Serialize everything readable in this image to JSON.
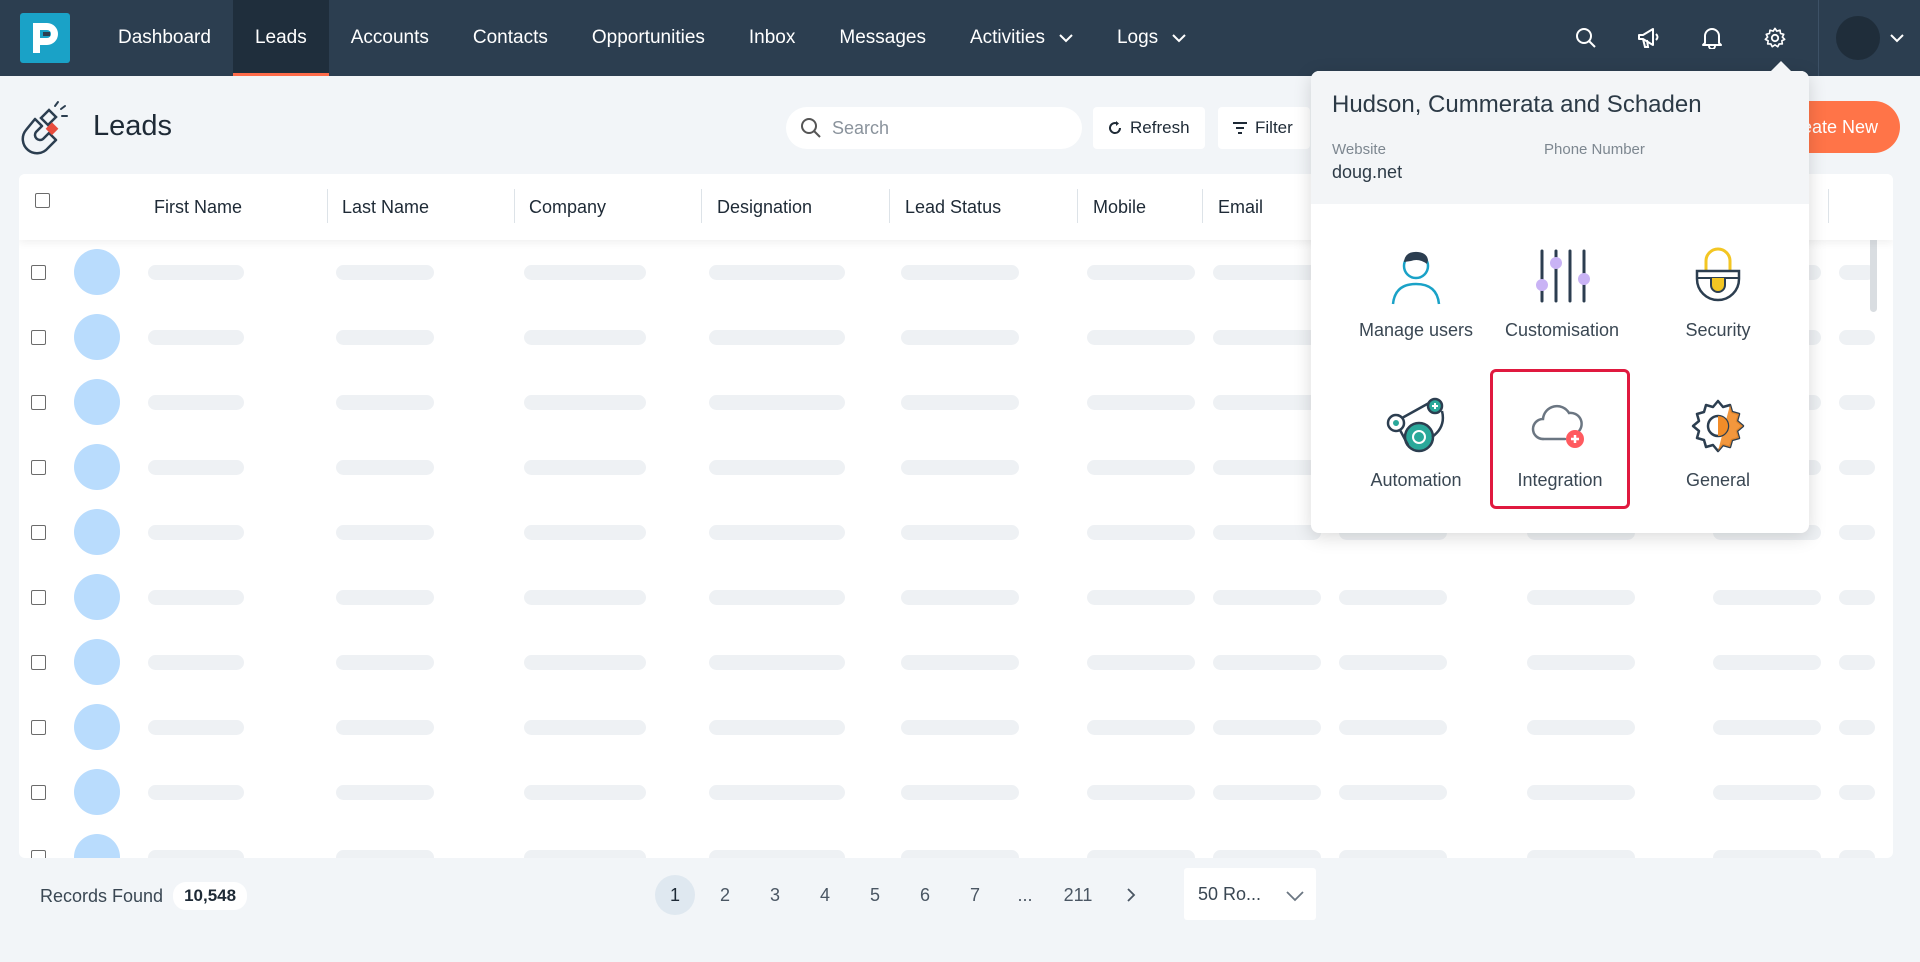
{
  "nav": {
    "items": [
      {
        "label": "Dashboard",
        "active": false,
        "has_menu": false
      },
      {
        "label": "Leads",
        "active": true,
        "has_menu": false
      },
      {
        "label": "Accounts",
        "active": false,
        "has_menu": false
      },
      {
        "label": "Contacts",
        "active": false,
        "has_menu": false
      },
      {
        "label": "Opportunities",
        "active": false,
        "has_menu": false
      },
      {
        "label": "Inbox",
        "active": false,
        "has_menu": false
      },
      {
        "label": "Messages",
        "active": false,
        "has_menu": false
      },
      {
        "label": "Activities",
        "active": true,
        "has_menu": true
      },
      {
        "label": "Logs",
        "active": false,
        "has_menu": true
      }
    ],
    "icons": [
      "search-icon",
      "megaphone-icon",
      "bell-icon",
      "gear-icon"
    ],
    "accent": "#ff6b4a",
    "bg": "#2c3e50"
  },
  "page": {
    "title": "Leads",
    "search_placeholder": "Search",
    "refresh_label": "Refresh",
    "filter_label": "Filter",
    "create_label": "eate New"
  },
  "table": {
    "columns": [
      "First Name",
      "Last Name",
      "Company",
      "Designation",
      "Lead Status",
      "Mobile",
      "Email"
    ],
    "loading_rows": 10
  },
  "footer": {
    "records_label": "Records Found",
    "records_count": "10,548",
    "pages": [
      "1",
      "2",
      "3",
      "4",
      "5",
      "6",
      "7",
      "...",
      "211"
    ],
    "current_page": "1",
    "rows_per_page": "50 Ro..."
  },
  "settings_menu": {
    "company": "Hudson, Cummerata and Schaden",
    "website_label": "Website",
    "website_value": "doug.net",
    "phone_label": "Phone Number",
    "phone_value": "",
    "tiles": [
      {
        "label": "Manage users",
        "icon": "user-icon"
      },
      {
        "label": "Customisation",
        "icon": "sliders-icon"
      },
      {
        "label": "Security",
        "icon": "lock-icon"
      },
      {
        "label": "Automation",
        "icon": "automation-icon"
      },
      {
        "label": "Integration",
        "icon": "cloud-plus-icon",
        "highlighted": true
      },
      {
        "label": "General",
        "icon": "gear-icon"
      }
    ],
    "highlight_color": "#e0193f"
  }
}
